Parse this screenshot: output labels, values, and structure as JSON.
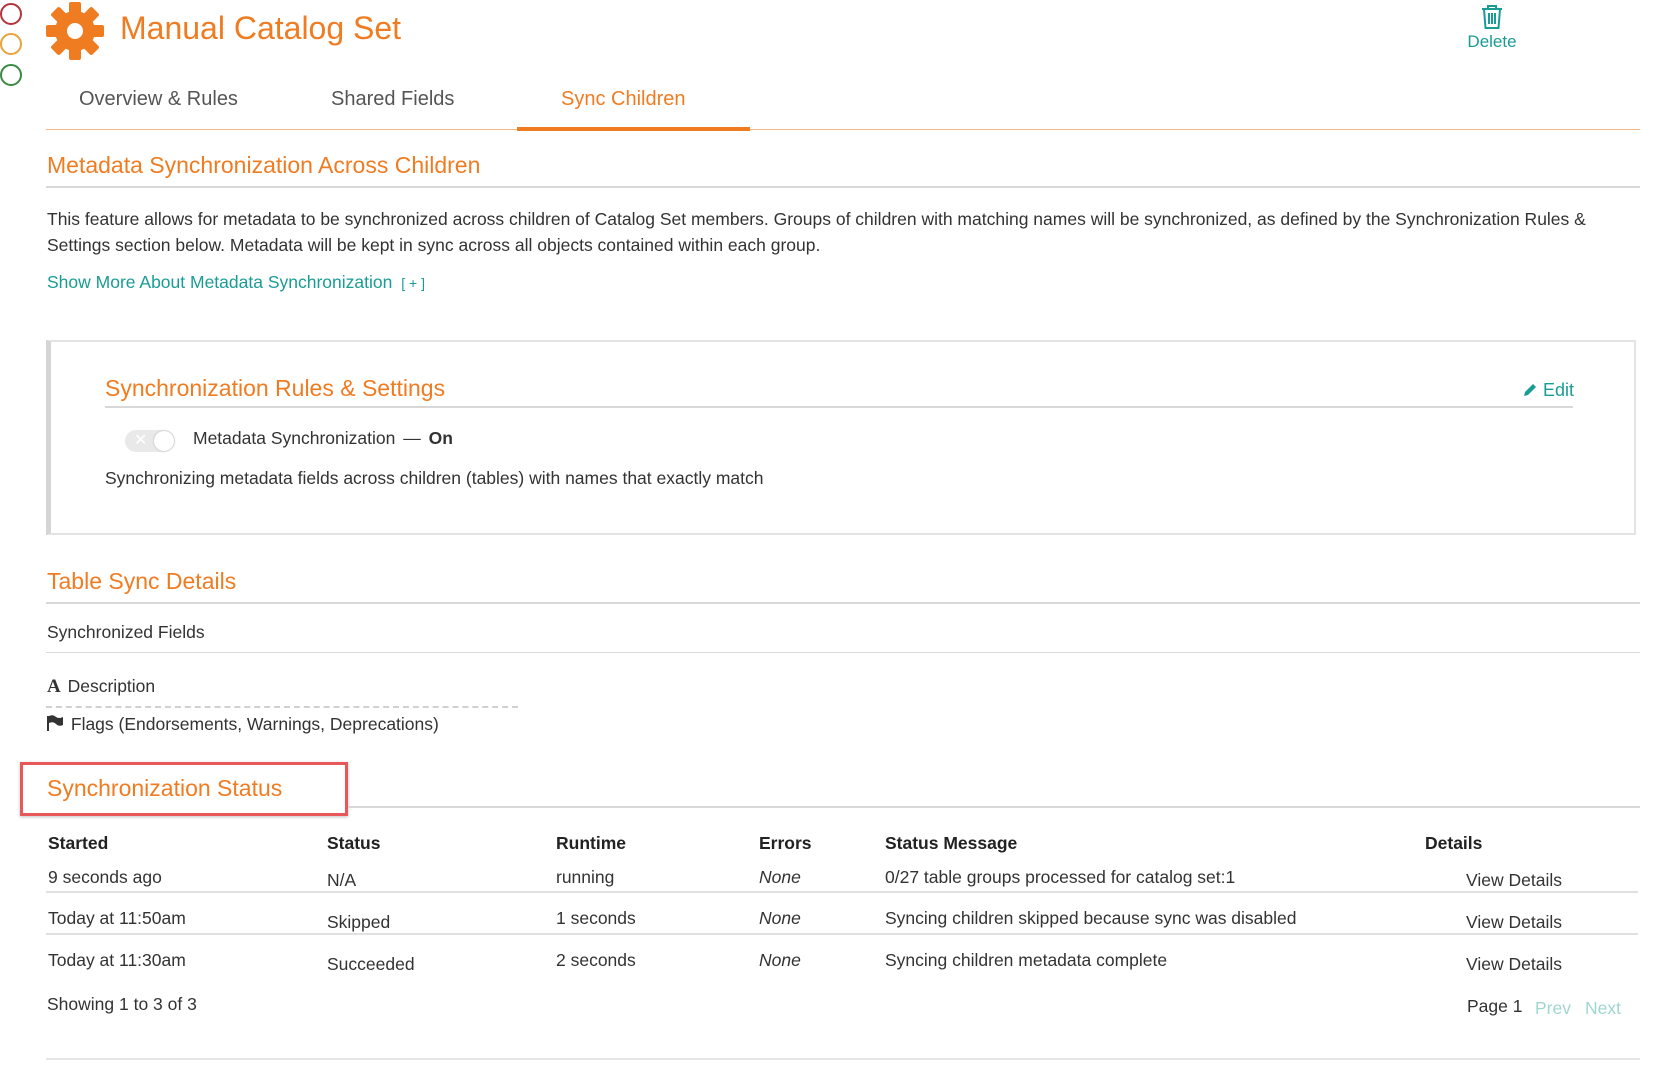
{
  "window": {
    "dot_colors": [
      "#b5343c",
      "#e8a33a",
      "#3a8a45"
    ]
  },
  "header": {
    "title": "Manual Catalog Set",
    "delete_label": "Delete",
    "icon": "gear-icon",
    "accent": "#f07c22",
    "link_color": "#1a9c95"
  },
  "tabs": [
    {
      "label": "Overview & Rules",
      "active": false
    },
    {
      "label": "Shared Fields",
      "active": false
    },
    {
      "label": "Sync Children",
      "active": true
    }
  ],
  "metadata_section": {
    "title": "Metadata Synchronization Across Children",
    "description": "This feature allows for metadata to be synchronized across children of Catalog Set members. Groups of children with matching names will be synchronized, as defined by the Synchronization Rules & Settings section below. Metadata will be kept in sync across all objects contained within each group.",
    "show_more_label": "Show More About Metadata Synchronization",
    "show_more_suffix": "[ + ]"
  },
  "rules_settings": {
    "title": "Synchronization Rules & Settings",
    "edit_label": "Edit",
    "toggle_label": "Metadata Synchronization",
    "toggle_dash": "—",
    "toggle_state": "On",
    "rule_text": "Synchronizing metadata fields across children (tables) with names that exactly match"
  },
  "table_sync": {
    "title": "Table Sync Details",
    "fields_heading": "Synchronized Fields",
    "fields": [
      {
        "icon": "text-a-icon",
        "label": "Description"
      },
      {
        "icon": "flag-icon",
        "label": "Flags (Endorsements, Warnings, Deprecations)"
      }
    ]
  },
  "sync_status": {
    "title": "Synchronization Status",
    "columns": [
      "Started",
      "Status",
      "Runtime",
      "Errors",
      "Status Message",
      "Details"
    ],
    "rows": [
      {
        "started": "9 seconds ago",
        "status": "N/A",
        "runtime": "running",
        "errors": "None",
        "message": "0/27 table groups processed for catalog set:1",
        "details": "View Details"
      },
      {
        "started": "Today at 11:50am",
        "status": "Skipped",
        "runtime": "1 seconds",
        "errors": "None",
        "message": "Syncing children skipped because sync was disabled",
        "details": "View Details"
      },
      {
        "started": "Today at 11:30am",
        "status": "Succeeded",
        "runtime": "2 seconds",
        "errors": "None",
        "message": "Syncing children metadata complete",
        "details": "View Details"
      }
    ],
    "footer": "Showing 1 to 3 of 3",
    "page_label": "Page 1",
    "prev_label": "Prev",
    "next_label": "Next"
  }
}
